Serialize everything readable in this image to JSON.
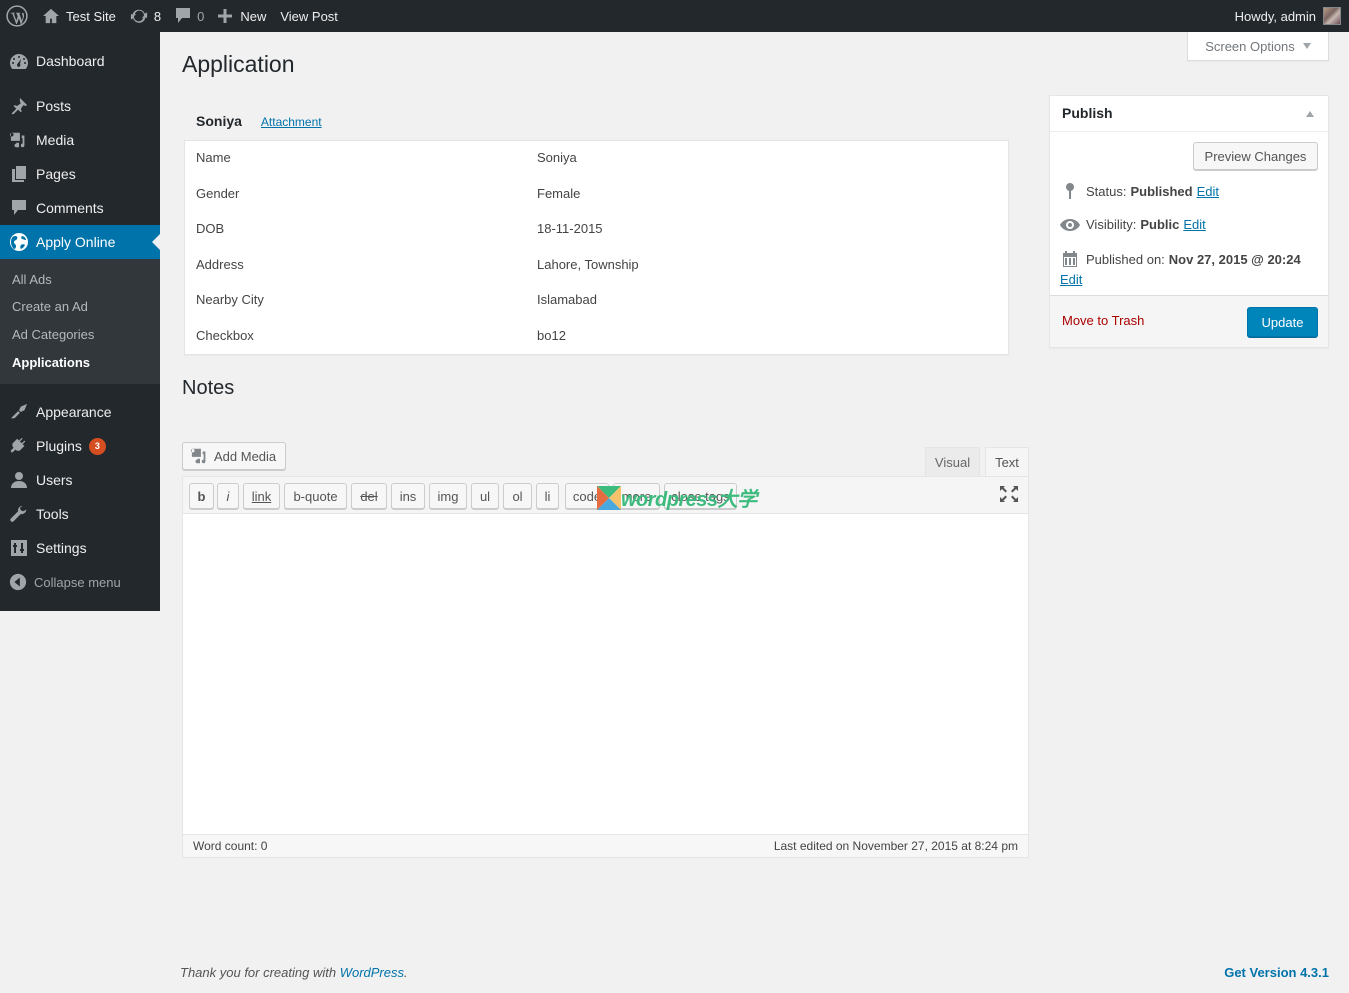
{
  "admin_bar": {
    "site_name": "Test Site",
    "updates_count": "8",
    "comments_count": "0",
    "new_label": "New",
    "view_post_label": "View Post",
    "howdy": "Howdy, admin"
  },
  "sidebar": {
    "items": [
      {
        "label": "Dashboard",
        "icon": "dashboard-icon"
      },
      {
        "label": "Posts",
        "icon": "pin-icon"
      },
      {
        "label": "Media",
        "icon": "media-icon"
      },
      {
        "label": "Pages",
        "icon": "pages-icon"
      },
      {
        "label": "Comments",
        "icon": "comment-icon"
      },
      {
        "label": "Apply Online",
        "icon": "globe-icon",
        "current": true
      },
      {
        "label": "Appearance",
        "icon": "paintbrush-icon"
      },
      {
        "label": "Plugins",
        "icon": "plugin-icon",
        "badge": "3"
      },
      {
        "label": "Users",
        "icon": "user-icon"
      },
      {
        "label": "Tools",
        "icon": "wrench-icon"
      },
      {
        "label": "Settings",
        "icon": "settings-icon"
      }
    ],
    "submenu": [
      {
        "label": "All Ads"
      },
      {
        "label": "Create an Ad"
      },
      {
        "label": "Ad Categories"
      },
      {
        "label": "Applications",
        "current": true
      }
    ],
    "collapse_label": "Collapse menu"
  },
  "screen_options_label": "Screen Options",
  "page_title": "Application",
  "application": {
    "applicant_name": "Soniya",
    "attachment_label": "Attachment",
    "fields": [
      {
        "label": "Name",
        "value": "Soniya"
      },
      {
        "label": "Gender",
        "value": "Female"
      },
      {
        "label": "DOB",
        "value": "18-11-2015"
      },
      {
        "label": "Address",
        "value": "Lahore, Township"
      },
      {
        "label": "Nearby City",
        "value": "Islamabad"
      },
      {
        "label": "Checkbox",
        "value": "bo12"
      }
    ]
  },
  "notes": {
    "heading": "Notes",
    "add_media_label": "Add Media",
    "tabs": {
      "visual": "Visual",
      "text": "Text",
      "active": "Text"
    },
    "quicktags": [
      "b",
      "i",
      "link",
      "b-quote",
      "del",
      "ins",
      "img",
      "ul",
      "ol",
      "li",
      "code",
      "more",
      "close tags"
    ],
    "content": "",
    "word_count": "Word count: 0",
    "last_edited": "Last edited on November 27, 2015 at 8:24 pm"
  },
  "watermark": {
    "text": "wordpress大学"
  },
  "publish": {
    "title": "Publish",
    "preview_label": "Preview Changes",
    "status_label": "Status:",
    "status_value": "Published",
    "visibility_label": "Visibility:",
    "visibility_value": "Public",
    "published_on_label": "Published on:",
    "published_on_value": "Nov 27, 2015 @ 20:24",
    "edit_label": "Edit",
    "trash_label": "Move to Trash",
    "update_label": "Update"
  },
  "footer": {
    "thanks_prefix": "Thank you for creating with ",
    "thanks_link": "WordPress",
    "thanks_suffix": ".",
    "version": "Get Version 4.3.1"
  },
  "colors": {
    "accent": "#0073aa",
    "admin_bar_bg": "#23282d",
    "submenu_bg": "#32373c",
    "badge": "#d54e21",
    "trash": "#aa0000",
    "update_btn": "#0085ba"
  }
}
